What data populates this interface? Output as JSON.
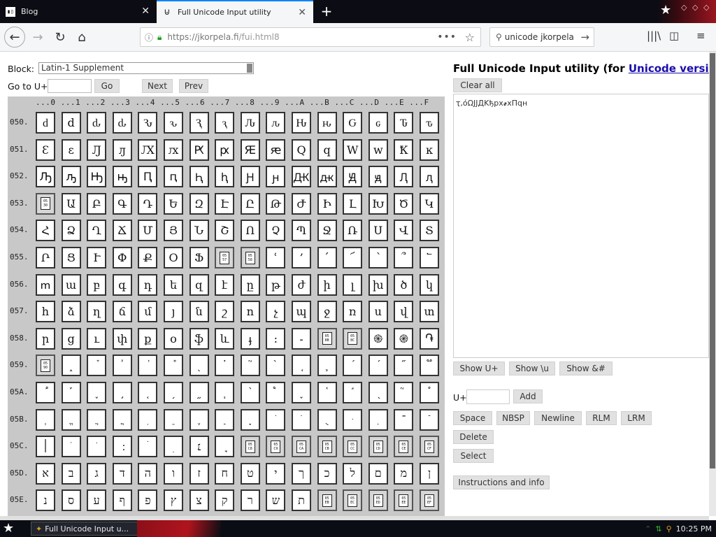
{
  "browser": {
    "tabs": [
      {
        "title": "Blog",
        "icon": "terminal-icon",
        "active": false
      },
      {
        "title": "Full Unicode Input utility",
        "icon": "tab-page-icon",
        "active": true
      }
    ],
    "new_tab_label": "+",
    "url_host": "https://jkorpela.fi",
    "url_path": "/fui.html8",
    "search_text": "unicode jkorpela"
  },
  "page": {
    "block_label": "Block:",
    "block_value": "Latin-1 Supplement",
    "goto_label": "Go to U+",
    "goto_value": "",
    "go_button": "Go",
    "next_button": "Next",
    "prev_button": "Prev",
    "column_header": "...0 ...1 ...2 ...3 ...4 ...5 ...6 ...7 ...8 ...9 ...A ...B ...C ...D ...E ...F",
    "grid": [
      {
        "row": "050.",
        "chars": [
          "ԁ",
          "d",
          "ԃ",
          "ԃ",
          "Ԅ",
          "ԅ",
          "Ԇ",
          "ԇ",
          "Ԉ",
          "ԉ",
          "Ԋ",
          "ԋ",
          "Ԍ",
          "ԍ",
          "Ԏ",
          "ԏ"
        ]
      },
      {
        "row": "051.",
        "chars": [
          "Ɛ",
          "ɛ",
          "Ԓ",
          "ԓ",
          "Ԕ",
          "ԕ",
          "Ԗ",
          "ԗ",
          "Ԙ",
          "ԙ",
          "Q",
          "q",
          "W",
          "w",
          "Ҟ",
          "ĸ"
        ]
      },
      {
        "row": "052.",
        "chars": [
          "Ԡ",
          "ԡ",
          "Ԣ",
          "ԣ",
          "Ԥ",
          "ԥ",
          "Ԧ",
          "ԧ",
          "Ԩ",
          "ԩ",
          "Ԫ",
          "ԫ",
          "Ԭ",
          "ԭ",
          "Ԯ",
          "ԯ"
        ]
      },
      {
        "row": "053.",
        "chars": [
          "@0530",
          "Ա",
          "Բ",
          "Գ",
          "Դ",
          "Ե",
          "Զ",
          "Է",
          "Ը",
          "Թ",
          "Ժ",
          "Ի",
          "Լ",
          "Խ",
          "Ծ",
          "Կ"
        ]
      },
      {
        "row": "054.",
        "chars": [
          "Հ",
          "Ձ",
          "Ղ",
          "Ճ",
          "Մ",
          "Յ",
          "Ն",
          "Շ",
          "Ո",
          "Չ",
          "Պ",
          "Ջ",
          "Ռ",
          "Ս",
          "Վ",
          "Տ"
        ]
      },
      {
        "row": "055.",
        "chars": [
          "Ր",
          "Ց",
          "Ւ",
          "Փ",
          "Ք",
          "Օ",
          "Ֆ",
          "@0557",
          "@0558",
          "ՙ",
          "՚",
          "՛",
          "՜",
          "՝",
          "՞",
          "՟"
        ]
      },
      {
        "row": "056.",
        "chars": [
          "ՠ",
          "ա",
          "բ",
          "գ",
          "դ",
          "ե",
          "զ",
          "է",
          "ը",
          "թ",
          "ժ",
          "ի",
          "լ",
          "խ",
          "ծ",
          "կ"
        ]
      },
      {
        "row": "057.",
        "chars": [
          "հ",
          "ձ",
          "ղ",
          "ճ",
          "մ",
          "յ",
          "ն",
          "շ",
          "ո",
          "չ",
          "պ",
          "ջ",
          "ռ",
          "ս",
          "վ",
          "տ"
        ]
      },
      {
        "row": "058.",
        "chars": [
          "ր",
          "ց",
          "ւ",
          "փ",
          "ք",
          "օ",
          "ֆ",
          "և",
          "ֈ",
          "։",
          "֊",
          "@058B",
          "@058C",
          "֍",
          "֎",
          "֏"
        ]
      },
      {
        "row": "059.",
        "chars": [
          "@0590",
          "֑",
          "֒",
          "֓",
          "֔",
          "֕",
          "֖",
          "֗",
          "֘",
          "֙",
          "֚",
          "֛",
          "֜",
          "֝",
          "֞",
          "֟"
        ]
      },
      {
        "row": "05A.",
        "chars": [
          "֠",
          "֡",
          "֢",
          "֣",
          "֤",
          "֥",
          "֦",
          "֧",
          "֨",
          "֩",
          "֪",
          "֫",
          "֬",
          "֭",
          "֮",
          "֯"
        ]
      },
      {
        "row": "05B.",
        "chars": [
          "ְ",
          "ֱ",
          "ֲ",
          "ֳ",
          "ִ",
          "ֵ",
          "ֶ",
          "ַ",
          "ָ",
          "ֹ",
          "ֺ",
          "ֻ",
          "ּ",
          "ֽ",
          "־",
          "ֿ"
        ]
      },
      {
        "row": "05C.",
        "chars": [
          "׀",
          "ׁ",
          "ׂ",
          "׃",
          "ׄ",
          "ׅ",
          "׆",
          "ׇ",
          "@05C8",
          "@05C9",
          "@05CA",
          "@05CB",
          "@05CC",
          "@05CD",
          "@05CE",
          "@05CF"
        ]
      },
      {
        "row": "05D.",
        "chars": [
          "א",
          "ב",
          "ג",
          "ד",
          "ה",
          "ו",
          "ז",
          "ח",
          "ט",
          "י",
          "ך",
          "כ",
          "ל",
          "ם",
          "מ",
          "ן"
        ]
      },
      {
        "row": "05E.",
        "chars": [
          "נ",
          "ס",
          "ע",
          "ף",
          "פ",
          "ץ",
          "צ",
          "ק",
          "ר",
          "ש",
          "ת",
          "@05EB",
          "@05EC",
          "@05ED",
          "@05EE",
          "@05EF"
        ]
      }
    ],
    "title_prefix": "Full Unicode Input utility (for ",
    "title_link": "Unicode version",
    "clear_all": "Clear all",
    "output_text": "ҭ,όΩJJДKђрх҂хПqн",
    "show_uplus": "Show U+",
    "show_u": "Show \\u",
    "show_amp": "Show &#",
    "uplus_label": "U+",
    "add_button": "Add",
    "space_button": "Space",
    "nbsp_button": "NBSP",
    "newline_button": "Newline",
    "rlm_button": "RLM",
    "lrm_button": "LRM",
    "delete_button": "Delete",
    "select_button": "Select",
    "instructions_button": "Instructions and info"
  },
  "taskbar": {
    "item": "Full Unicode Input u...",
    "clock": "10:25 PM"
  }
}
